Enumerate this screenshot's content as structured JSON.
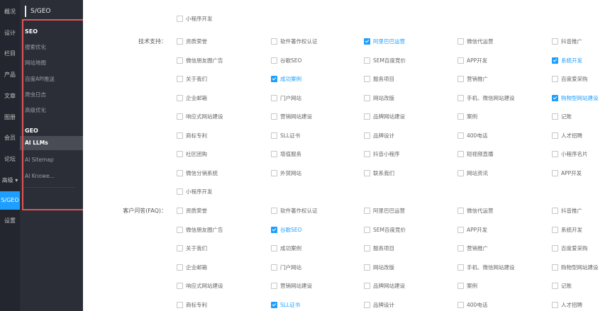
{
  "rail": [
    "概况",
    "设计",
    "栏目",
    "产品",
    "文章",
    "图册",
    "会员",
    "论坛",
    "高级 ▾",
    "S/GEO",
    "设置"
  ],
  "rail_active": 9,
  "panel": {
    "title": "S/GEO",
    "seo_label": "SEO",
    "seo_items": [
      "搜索优化",
      "网站地图",
      "百度API推送",
      "爬虫日志",
      "高级优化"
    ],
    "geo_label": "GEO",
    "geo_items": [
      "AI LLMs",
      "AI Sitemap",
      "AI Knowe..."
    ],
    "geo_active": 0
  },
  "top_partial": [
    "小程序开发"
  ],
  "sections": [
    {
      "label": "技术支持：",
      "rows": [
        [
          {
            "t": "资质荣誉",
            "c": false
          },
          {
            "t": "软件著作权认证",
            "c": false
          },
          {
            "t": "阿里巴巴运营",
            "c": true
          },
          {
            "t": "微信代运营",
            "c": false
          },
          {
            "t": "抖音推广",
            "c": false
          }
        ],
        [
          {
            "t": "微信朋友圈广告",
            "c": false
          },
          {
            "t": "谷歌SEO",
            "c": false
          },
          {
            "t": "SEM百度竞价",
            "c": false
          },
          {
            "t": "APP开发",
            "c": false
          },
          {
            "t": "系统开发",
            "c": true
          }
        ],
        [
          {
            "t": "关于我们",
            "c": false
          },
          {
            "t": "成功案例",
            "c": true
          },
          {
            "t": "服务项目",
            "c": false
          },
          {
            "t": "营销推广",
            "c": false
          },
          {
            "t": "百度爱采购",
            "c": false
          }
        ],
        [
          {
            "t": "企业邮箱",
            "c": false
          },
          {
            "t": "门户网站",
            "c": false
          },
          {
            "t": "网站改版",
            "c": false
          },
          {
            "t": "手机、微信网站建设",
            "c": false
          },
          {
            "t": "购物型网站建设",
            "c": true
          }
        ],
        [
          {
            "t": "响应式网站建设",
            "c": false
          },
          {
            "t": "营销网站建设",
            "c": false
          },
          {
            "t": "品牌网站建设",
            "c": false
          },
          {
            "t": "案例",
            "c": false
          },
          {
            "t": "记账",
            "c": false
          }
        ],
        [
          {
            "t": "商标专利",
            "c": false
          },
          {
            "t": "SLL证书",
            "c": false
          },
          {
            "t": "品牌设计",
            "c": false
          },
          {
            "t": "400电话",
            "c": false
          },
          {
            "t": "人才招聘",
            "c": false
          }
        ],
        [
          {
            "t": "社区团购",
            "c": false
          },
          {
            "t": "增值服务",
            "c": false
          },
          {
            "t": "抖音小程序",
            "c": false
          },
          {
            "t": "短视频直播",
            "c": false
          },
          {
            "t": "小程序名片",
            "c": false
          }
        ],
        [
          {
            "t": "微信分销系统",
            "c": false
          },
          {
            "t": "外贸网站",
            "c": false
          },
          {
            "t": "联系我们",
            "c": false
          },
          {
            "t": "网站资讯",
            "c": false
          },
          {
            "t": "APP开发",
            "c": false
          }
        ],
        [
          {
            "t": "小程序开发",
            "c": false
          }
        ]
      ]
    },
    {
      "label": "客户问答(FAQ)：",
      "rows": [
        [
          {
            "t": "资质荣誉",
            "c": false
          },
          {
            "t": "软件著作权认证",
            "c": false
          },
          {
            "t": "阿里巴巴运营",
            "c": false
          },
          {
            "t": "微信代运营",
            "c": false
          },
          {
            "t": "抖音推广",
            "c": false
          }
        ],
        [
          {
            "t": "微信朋友圈广告",
            "c": false
          },
          {
            "t": "谷歌SEO",
            "c": true
          },
          {
            "t": "SEM百度竞价",
            "c": false
          },
          {
            "t": "APP开发",
            "c": false
          },
          {
            "t": "系统开发",
            "c": false
          }
        ],
        [
          {
            "t": "关于我们",
            "c": false
          },
          {
            "t": "成功案例",
            "c": false
          },
          {
            "t": "服务项目",
            "c": false
          },
          {
            "t": "营销推广",
            "c": false
          },
          {
            "t": "百度爱采购",
            "c": false
          }
        ],
        [
          {
            "t": "企业邮箱",
            "c": false
          },
          {
            "t": "门户网站",
            "c": false
          },
          {
            "t": "网站改版",
            "c": false
          },
          {
            "t": "手机、微信网站建设",
            "c": false
          },
          {
            "t": "购物型网站建设",
            "c": false
          }
        ],
        [
          {
            "t": "响应式网站建设",
            "c": false
          },
          {
            "t": "营销网站建设",
            "c": false
          },
          {
            "t": "品牌网站建设",
            "c": false
          },
          {
            "t": "案例",
            "c": false
          },
          {
            "t": "记账",
            "c": false
          }
        ],
        [
          {
            "t": "商标专利",
            "c": false
          },
          {
            "t": "SLL证书",
            "c": true
          },
          {
            "t": "品牌设计",
            "c": false
          },
          {
            "t": "400电话",
            "c": false
          },
          {
            "t": "人才招聘",
            "c": false
          }
        ]
      ]
    }
  ],
  "colors": {
    "accent": "#1e9fff",
    "rail_bg": "#23262e",
    "panel_bg": "#2b2e37",
    "highlight": "#e25555"
  }
}
